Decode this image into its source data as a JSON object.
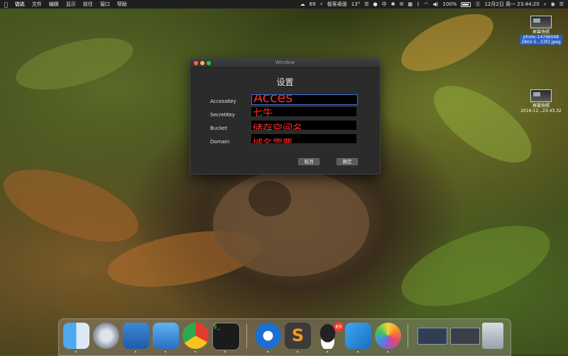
{
  "menubar": {
    "app_name": "访达",
    "menus": [
      "文件",
      "编辑",
      "显示",
      "前往",
      "窗口",
      "帮助"
    ],
    "status": {
      "notification_count": "69",
      "app_label": "极客桌面",
      "weather": "13°",
      "input_method": "中",
      "battery": "100%",
      "datetime": "12月2日 周一  23:44:20"
    }
  },
  "desktop": {
    "icons": [
      {
        "title": "屏幕快照",
        "caption": "photo-14796048\n2802-5...53f2.jpeg",
        "selected": true
      },
      {
        "title": "屏幕快照",
        "caption": "2019-12...23.43.32",
        "selected": false
      }
    ]
  },
  "window": {
    "title": "Window",
    "heading": "设置",
    "rows": [
      {
        "label": "AccessKey",
        "value": "Acces"
      },
      {
        "label": "SecretKey",
        "value": "七牛"
      },
      {
        "label": "Bucket",
        "value": "储存空间名"
      },
      {
        "label": "Domain",
        "value": "域名需要"
      }
    ],
    "cancel_label": "取消",
    "ok_label": "确定"
  },
  "dock": {
    "apps": [
      "finder-icon",
      "launchpad-icon",
      "xcode-icon",
      "simulator-icon",
      "chrome-icon",
      "terminal-icon",
      "sourcetree-icon",
      "sublime-icon",
      "qq-icon",
      "vscode-icon",
      "photos-icon",
      "window-preview-1",
      "window-preview-2",
      "trash-icon"
    ],
    "qq_badge": "69"
  },
  "colors": {
    "menubar_bg": "#1f1f1f",
    "field_text": "#ff2a2a",
    "accent_select": "#2a5fc8"
  }
}
